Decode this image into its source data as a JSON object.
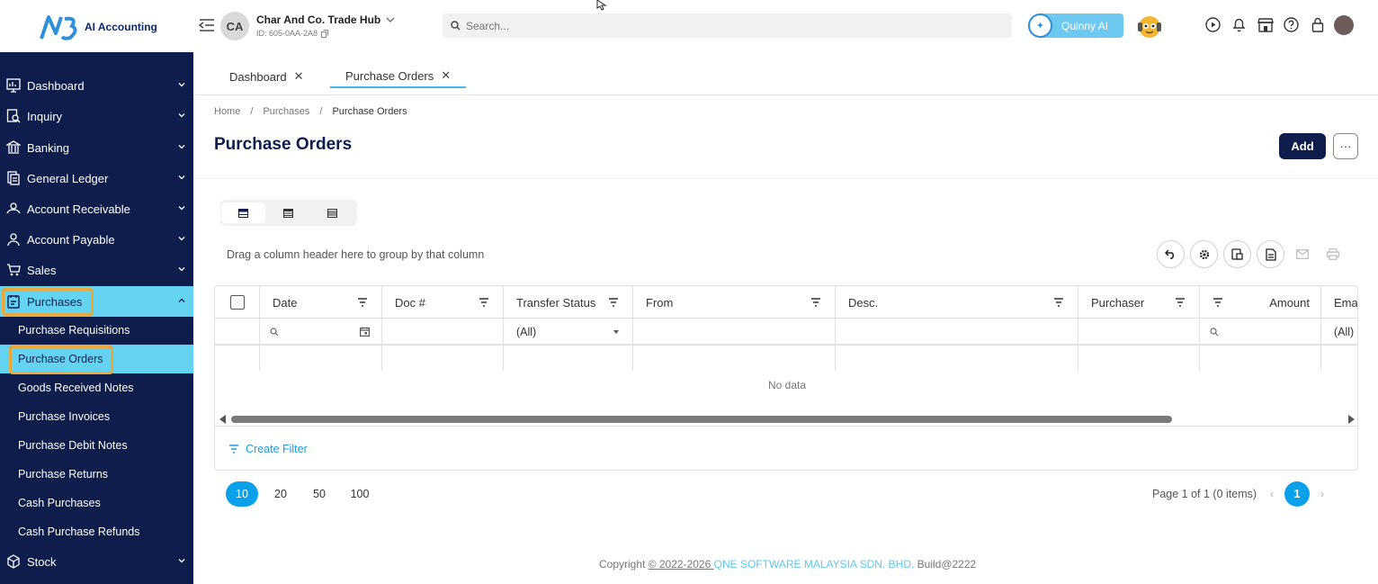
{
  "app": {
    "logo_text": "AI Accounting",
    "company_initials": "CA",
    "company_name": "Char And Co. Trade Hub",
    "company_id": "ID: 605-0AA-2A8",
    "search_placeholder": "Search...",
    "assistant_label": "Quinny AI"
  },
  "sidebar": {
    "items": [
      {
        "label": "Dashboard",
        "icon": "chart-icon"
      },
      {
        "label": "Inquiry",
        "icon": "inquiry-icon"
      },
      {
        "label": "Banking",
        "icon": "bank-icon"
      },
      {
        "label": "General Ledger",
        "icon": "ledger-icon"
      },
      {
        "label": "Account Receivable",
        "icon": "receivable-icon"
      },
      {
        "label": "Account Payable",
        "icon": "payable-icon"
      },
      {
        "label": "Sales",
        "icon": "cart-icon"
      },
      {
        "label": "Purchases",
        "icon": "purchases-icon"
      },
      {
        "label": "Stock",
        "icon": "box-icon"
      }
    ],
    "purchases_sub": [
      "Purchase Requisitions",
      "Purchase Orders",
      "Goods Received Notes",
      "Purchase Invoices",
      "Purchase Debit Notes",
      "Purchase Returns",
      "Cash Purchases",
      "Cash Purchase Refunds"
    ]
  },
  "tabs": [
    {
      "label": "Dashboard"
    },
    {
      "label": "Purchase Orders"
    }
  ],
  "breadcrumb": [
    "Home",
    "Purchases",
    "Purchase Orders"
  ],
  "page": {
    "title": "Purchase Orders",
    "add_label": "Add",
    "more_label": "···",
    "group_hint": "Drag a column header here to group by that column"
  },
  "grid": {
    "columns": [
      "Date",
      "Doc #",
      "Transfer Status",
      "From",
      "Desc.",
      "Purchaser",
      "Amount",
      "Ema"
    ],
    "transfer_filter": "(All)",
    "email_filter": "(All)",
    "no_data": "No data",
    "create_filter": "Create Filter"
  },
  "pagination": {
    "sizes": [
      "10",
      "20",
      "50",
      "100"
    ],
    "info": "Page 1 of 1 (0 items)",
    "current": "1",
    "prev": "‹",
    "next": "›"
  },
  "footer": {
    "prefix": "Copyright ",
    "symbol": "©",
    "years": " 2022-2026 ",
    "company": "QNE SOFTWARE MALAYSIA SDN. BHD.",
    "build": " Build@2222"
  }
}
